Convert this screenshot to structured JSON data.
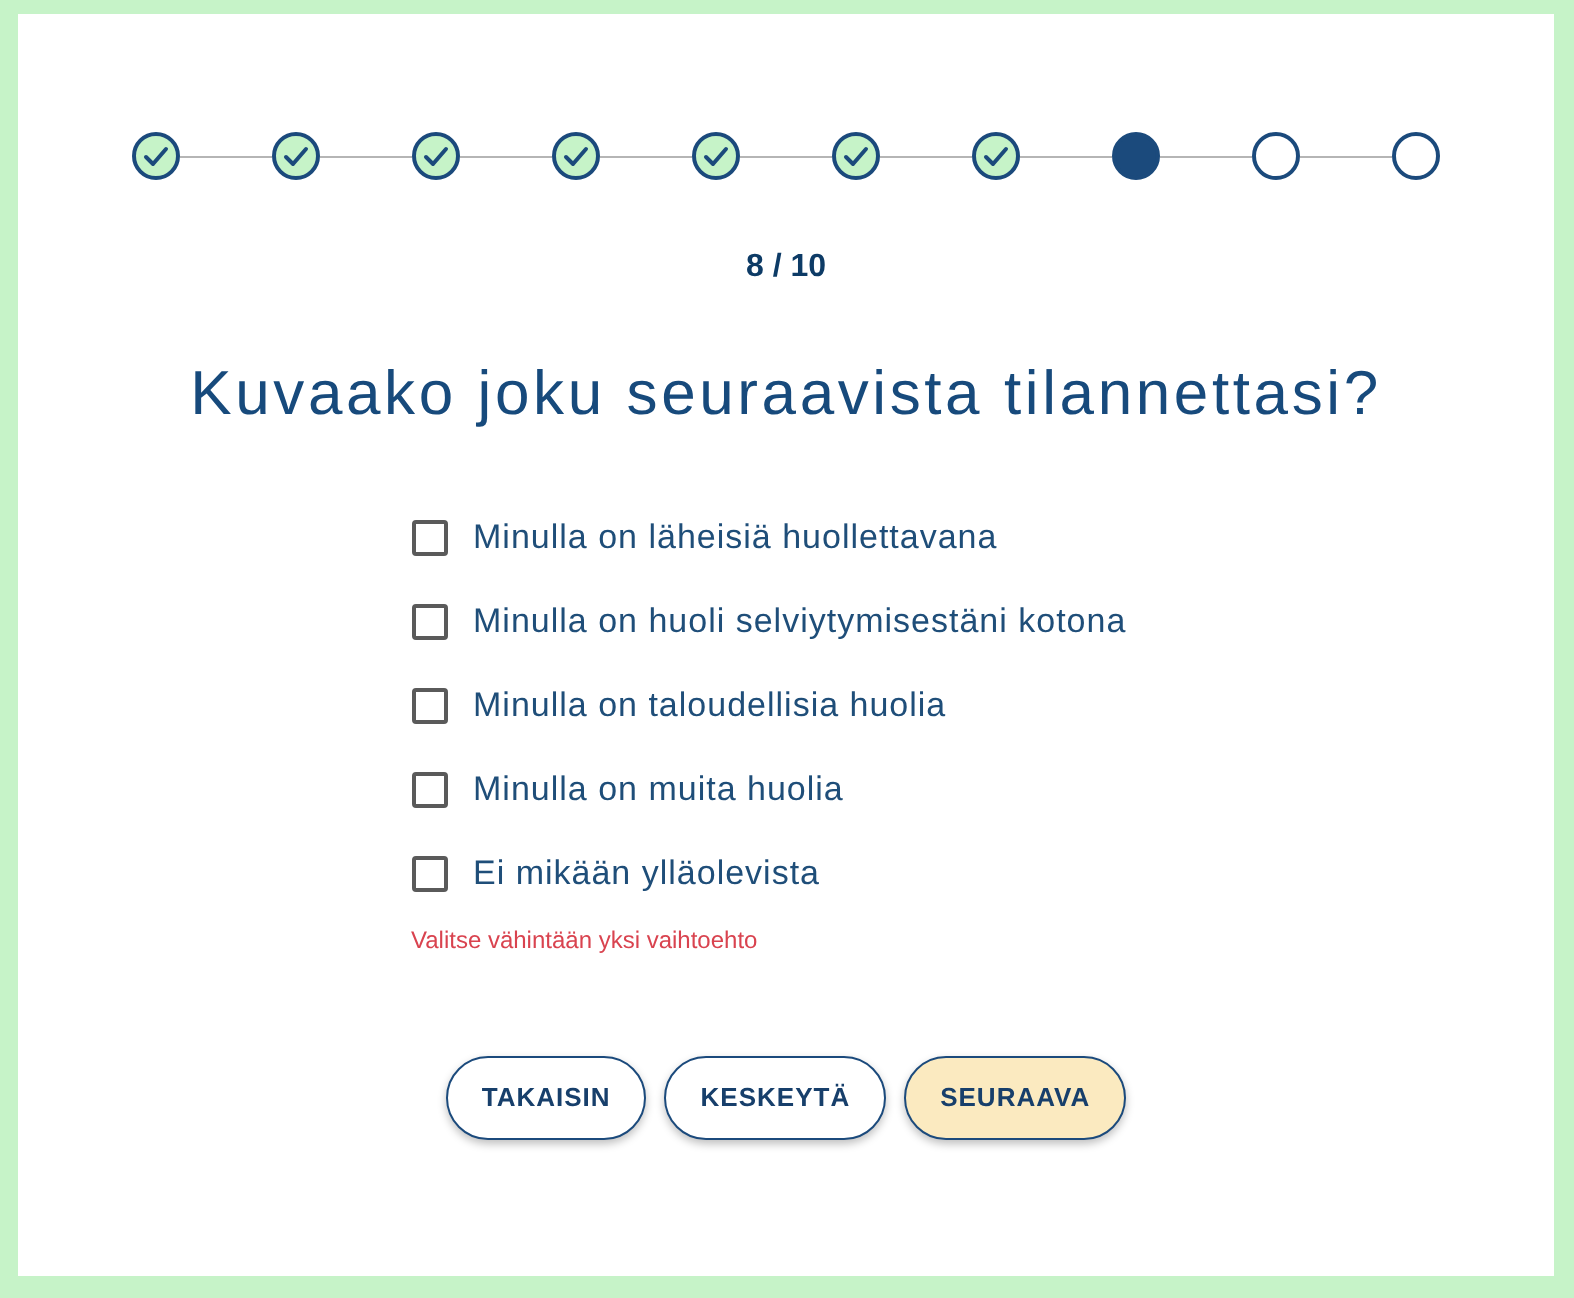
{
  "progress": {
    "steps": [
      {
        "completed": true,
        "selected": false
      },
      {
        "completed": true,
        "selected": false
      },
      {
        "completed": true,
        "selected": false
      },
      {
        "completed": true,
        "selected": false
      },
      {
        "completed": true,
        "selected": false
      },
      {
        "completed": true,
        "selected": false
      },
      {
        "completed": true,
        "selected": false
      },
      {
        "completed": false,
        "selected": true
      },
      {
        "completed": false,
        "selected": false
      },
      {
        "completed": false,
        "selected": false
      }
    ],
    "counter": "8 / 10"
  },
  "question": "Kuvaako joku seuraavista tilannettasi?",
  "options": [
    {
      "label": "Minulla on läheisiä huollettavana",
      "checked": false
    },
    {
      "label": "Minulla on huoli selviytymisestäni kotona",
      "checked": false
    },
    {
      "label": "Minulla on taloudellisia huolia",
      "checked": false
    },
    {
      "label": "Minulla on muita huolia",
      "checked": false
    },
    {
      "label": "Ei mikään ylläolevista",
      "checked": false
    }
  ],
  "error": "Valitse vähintään yksi vaihtoehto",
  "buttons": [
    {
      "label": "TAKAISIN",
      "kind": "outline"
    },
    {
      "label": "KESKEYTÄ",
      "kind": "outline"
    },
    {
      "label": "SEURAAVA",
      "kind": "primary"
    }
  ]
}
